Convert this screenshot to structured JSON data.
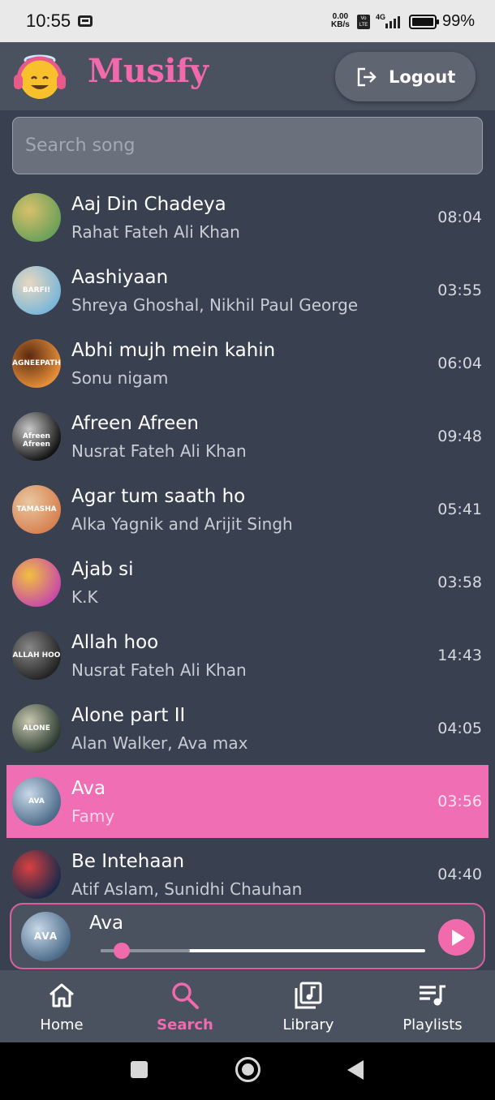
{
  "status_bar": {
    "time": "10:55",
    "speed_value": "0.00",
    "speed_unit": "KB/s",
    "volte": "Vo LTE",
    "network": "4G",
    "battery": "99%"
  },
  "header": {
    "app_title": "Musify",
    "logo_icon": "emoji-headphones-icon",
    "logout_label": "Logout"
  },
  "search": {
    "placeholder": "Search song"
  },
  "songs": [
    {
      "title": "Aaj Din Chadeya",
      "artist": "Rahat Fateh Ali Khan",
      "duration": "08:04",
      "art_colors": [
        "#6aa05a",
        "#d8c06a"
      ]
    },
    {
      "title": "Aashiyaan",
      "artist": "Shreya Ghoshal, Nikhil Paul George",
      "duration": "03:55",
      "art_colors": [
        "#7ab6d8",
        "#e8d8c0"
      ],
      "art_text": "BARFI!"
    },
    {
      "title": "Abhi mujh mein kahin",
      "artist": "Sonu nigam",
      "duration": "06:04",
      "art_colors": [
        "#e8903a",
        "#5a2a10"
      ],
      "art_text": "AGNEEPATH"
    },
    {
      "title": "Afreen Afreen",
      "artist": "Nusrat Fateh Ali Khan",
      "duration": "09:48",
      "art_colors": [
        "#111111",
        "#c8c8c8"
      ],
      "art_text": "Afreen Afreen"
    },
    {
      "title": "Agar tum saath ho",
      "artist": "Alka Yagnik and Arijit Singh",
      "duration": "05:41",
      "art_colors": [
        "#d88050",
        "#e8c8a0"
      ],
      "art_text": "TAMASHA"
    },
    {
      "title": "Ajab si",
      "artist": "K.K",
      "duration": "03:58",
      "art_colors": [
        "#c84aa8",
        "#f0c040"
      ]
    },
    {
      "title": "Allah hoo",
      "artist": "Nusrat Fateh Ali Khan",
      "duration": "14:43",
      "art_colors": [
        "#222222",
        "#888888"
      ],
      "art_text": "ALLAH HOO"
    },
    {
      "title": "Alone part II",
      "artist": "Alan Walker, Ava max",
      "duration": "04:05",
      "art_colors": [
        "#2a3a30",
        "#c8c8b0"
      ],
      "art_text": "ALONE"
    },
    {
      "title": "Ava",
      "artist": "Famy",
      "duration": "03:56",
      "art_colors": [
        "#4a6a88",
        "#c8d8e8"
      ],
      "art_text": "AVA",
      "active": true
    },
    {
      "title": "Be Intehaan",
      "artist": "Atif Aslam, Sunidhi Chauhan",
      "duration": "04:40",
      "art_colors": [
        "#1a2a4a",
        "#d84040"
      ]
    }
  ],
  "now_playing": {
    "title": "Ava",
    "art_text": "AVA",
    "progress": 0.04,
    "play_icon": "play-icon"
  },
  "bottom_nav": [
    {
      "label": "Home",
      "icon": "home-icon"
    },
    {
      "label": "Search",
      "icon": "search-icon",
      "selected": true
    },
    {
      "label": "Library",
      "icon": "library-music-icon"
    },
    {
      "label": "Playlists",
      "icon": "playlist-music-icon"
    }
  ],
  "colors": {
    "accent": "#f06aac",
    "background": "#394151",
    "surface": "#4a5260"
  }
}
